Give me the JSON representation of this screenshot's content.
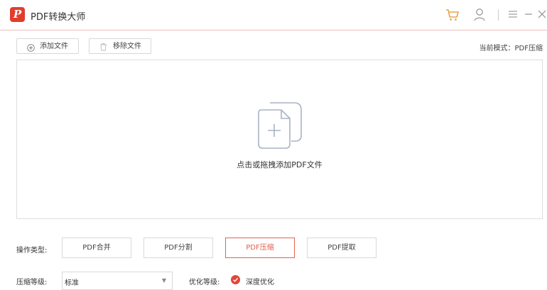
{
  "app": {
    "title": "PDF转换大师",
    "logo_letter": "P",
    "accent_color": "#e23d2c"
  },
  "titlebar": {
    "icons": [
      "cart-icon",
      "user-icon",
      "menu-icon",
      "minimize-icon",
      "close-icon"
    ]
  },
  "toolbar": {
    "add_file_label": "添加文件",
    "remove_file_label": "移除文件",
    "mode_text": "当前模式：PDF压缩"
  },
  "dropzone": {
    "hint": "点击或拖拽添加PDF文件"
  },
  "operations": {
    "label": "操作类型:",
    "items": [
      {
        "label": "PDF合并",
        "active": false
      },
      {
        "label": "PDF分割",
        "active": false
      },
      {
        "label": "PDF压缩",
        "active": true
      },
      {
        "label": "PDF提取",
        "active": false
      }
    ]
  },
  "compression": {
    "level_label": "压缩等级:",
    "level_value": "标准",
    "optimize_label": "优化等级:",
    "optimize_value": "深度优化"
  }
}
